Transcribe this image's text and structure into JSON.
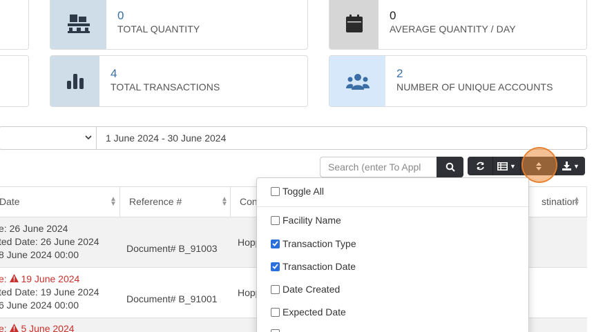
{
  "cards": {
    "total_quantity": {
      "value": "0",
      "label": "TOTAL QUANTITY"
    },
    "average_quantity": {
      "value": "0",
      "label": "AVERAGE QUANTITY / DAY"
    },
    "total_transactions": {
      "value": "4",
      "label": "TOTAL TRANSACTIONS"
    },
    "unique_accounts": {
      "value": "2",
      "label": "NUMBER OF UNIQUE ACCOUNTS"
    }
  },
  "filters": {
    "date_range": "1 June 2024 - 30 June 2024"
  },
  "search": {
    "placeholder": "Search (enter To Appl"
  },
  "table": {
    "headers": {
      "date": "Date",
      "reference": "Reference #",
      "contact": "Cont",
      "destination": "stination"
    },
    "rows": [
      {
        "line1": "e: 26 June 2024",
        "line2": "ted Date: 26 June 2024",
        "line3": "8 June 2024 00:00",
        "reference": "Document# B_91003",
        "contact": "Hopp",
        "overdue": false
      },
      {
        "line1_prefix": "e:",
        "line1_date": "19 June 2024",
        "line2": "ted Date: 19 June 2024",
        "line3": "6 June 2024 00:00",
        "reference": "Document# B_91001",
        "contact": "Hopp",
        "overdue": true
      },
      {
        "line1_prefix": "e:",
        "line1_date": "5 June 2024",
        "overdue": true
      }
    ]
  },
  "column_toggle": {
    "toggle_all": "Toggle All",
    "items": [
      {
        "label": "Facility Name",
        "checked": false
      },
      {
        "label": "Transaction Type",
        "checked": true
      },
      {
        "label": "Transaction Date",
        "checked": true
      },
      {
        "label": "Date Created",
        "checked": false
      },
      {
        "label": "Expected Date",
        "checked": false
      }
    ]
  },
  "colors": {
    "accent_blue": "#2a6fdb",
    "value_blue": "#3a6ea5",
    "dark_button": "#2f3136",
    "highlight": "#eb8c3c",
    "warning_red": "#c9302c"
  }
}
